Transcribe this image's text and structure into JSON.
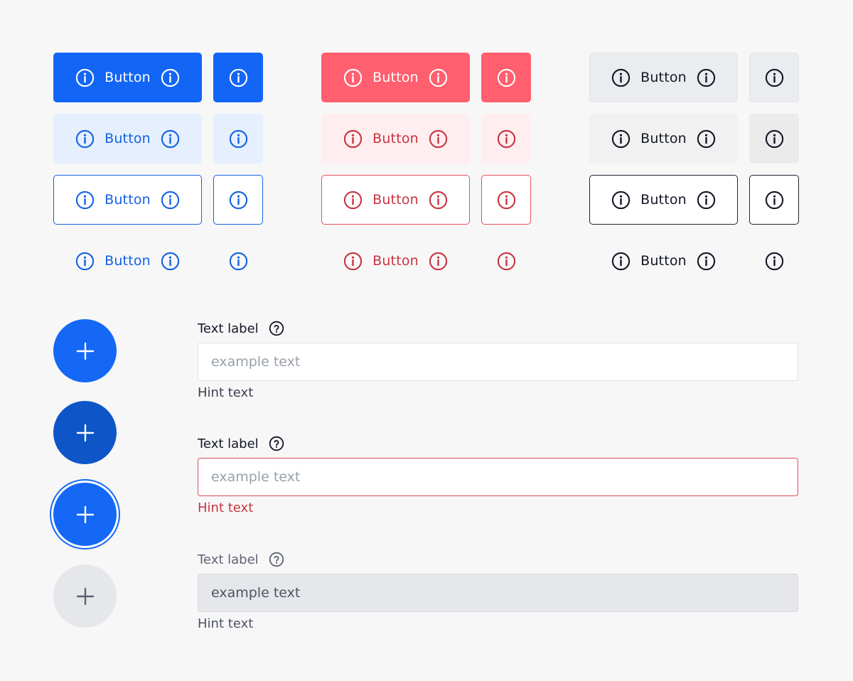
{
  "buttons": {
    "label": "Button",
    "icon": "info-icon",
    "groups": [
      {
        "name": "primary",
        "color": "#1366f5",
        "variants": [
          "solid",
          "soft",
          "outline",
          "ghost"
        ]
      },
      {
        "name": "danger",
        "color": "#ff5f6e",
        "variants": [
          "solid",
          "soft",
          "outline",
          "ghost"
        ]
      },
      {
        "name": "neutral",
        "color": "#141826",
        "variants": [
          "solid",
          "soft",
          "outline",
          "ghost"
        ]
      }
    ]
  },
  "fabs": {
    "icon": "plus-icon",
    "states": [
      "default",
      "pressed",
      "focused",
      "disabled"
    ]
  },
  "fields": [
    {
      "state": "default",
      "label": "Text label",
      "placeholder": "example text",
      "hint": "Hint text",
      "help_icon": "question-circle-icon"
    },
    {
      "state": "error",
      "label": "Text label",
      "placeholder": "example text",
      "hint": "Hint text",
      "help_icon": "question-circle-icon"
    },
    {
      "state": "disabled",
      "label": "Text label",
      "placeholder": "example text",
      "hint": "Hint text",
      "help_icon": "question-circle-icon"
    }
  ],
  "colors": {
    "primary": "#1366f5",
    "primary_pressed": "#0e55c8",
    "danger": "#ff5f6e",
    "danger_text": "#c9343f",
    "neutral_text": "#141826",
    "page_background": "#f7f7f8"
  }
}
